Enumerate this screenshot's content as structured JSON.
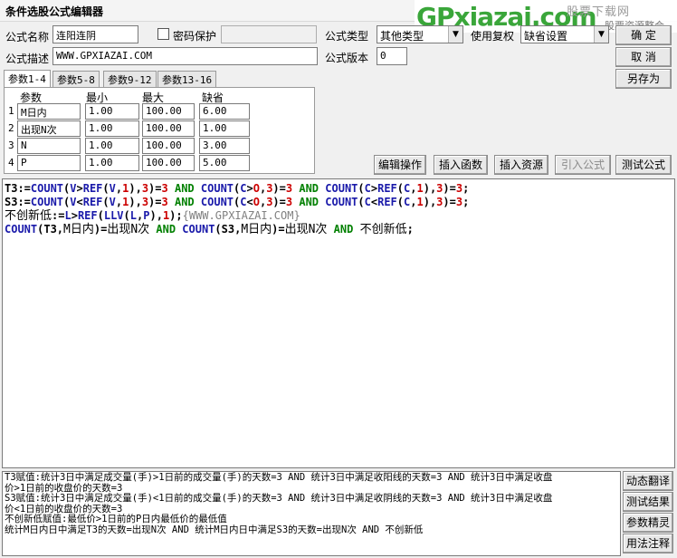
{
  "window": {
    "title": "条件选股公式编辑器"
  },
  "form": {
    "name_label": "公式名称",
    "name_value": "连阳连阴",
    "password_label": "密码保护",
    "desc_label": "公式描述",
    "desc_value": "WWW.GPXIAZAI.COM",
    "type_label": "公式类型",
    "type_value": "其他类型",
    "usage_label": "使用复权",
    "usage_value": "缺省设置",
    "version_label": "公式版本",
    "version_value": "0"
  },
  "buttons": {
    "ok": "确  定",
    "cancel": "取  消",
    "save_as": "另存为",
    "edit_ops": "编辑操作",
    "insert_func": "插入函数",
    "insert_res": "插入资源",
    "import": "引入公式",
    "test": "测试公式"
  },
  "tabs": [
    "参数1-4",
    "参数5-8",
    "参数9-12",
    "参数13-16"
  ],
  "params": {
    "headers": {
      "name": "参数",
      "min": "最小",
      "max": "最大",
      "default": "缺省"
    },
    "rows": [
      {
        "no": "1",
        "name": "M日内",
        "min": "1.00",
        "max": "100.00",
        "default": "6.00"
      },
      {
        "no": "2",
        "name": "出现N次",
        "min": "1.00",
        "max": "100.00",
        "default": "1.00"
      },
      {
        "no": "3",
        "name": "N",
        "min": "1.00",
        "max": "100.00",
        "default": "3.00"
      },
      {
        "no": "4",
        "name": "P",
        "min": "1.00",
        "max": "100.00",
        "default": "5.00"
      }
    ]
  },
  "code": {
    "line3_name": "不创新低",
    "line3_comment": "{WWW.GPXIAZAI.COM}",
    "line4_p1": "M日内",
    "line4_p2": "出现N次",
    "line4_p3": "M日内",
    "line4_p4": "出现N次",
    "line4_p5": "不创新低"
  },
  "output": {
    "lines": [
      "T3赋值:统计3日中满足成交量(手)>1日前的成交量(手)的天数=3 AND 统计3日中满足收阳线的天数=3 AND 统计3日中满足收盘",
      "价>1日前的收盘价的天数=3",
      "S3赋值:统计3日中满足成交量(手)<1日前的成交量(手)的天数=3 AND 统计3日中满足收阴线的天数=3 AND 统计3日中满足收盘",
      "价<1日前的收盘价的天数=3",
      "不创新低赋值:最低价>1日前的P日内最低价的最低值",
      "统计M日内日中满足T3的天数=出现N次 AND 统计M日内日中满足S3的天数=出现N次 AND 不创新低"
    ]
  },
  "side_buttons": [
    "动态翻译",
    "测试结果",
    "参数精灵",
    "用法注释"
  ],
  "watermark": {
    "brand": "GPxiazai.com",
    "line1": "股票下载网",
    "line2": "股票资源整合"
  }
}
